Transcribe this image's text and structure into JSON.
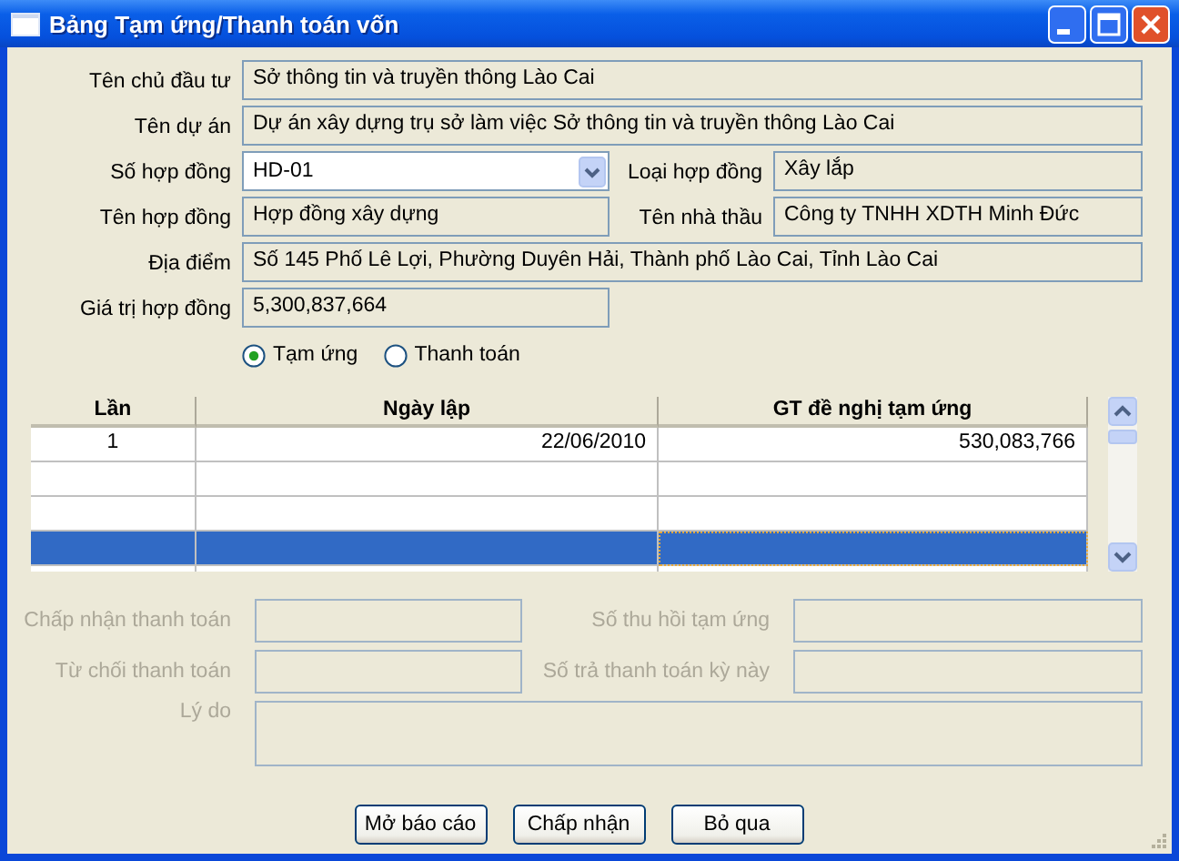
{
  "window": {
    "title": "Bảng Tạm ứng/Thanh toán vốn"
  },
  "fields": [
    {
      "kind": "wide",
      "label": "Tên chủ đầu tư",
      "value": "Sở thông tin và truyền thông Lào Cai"
    },
    {
      "kind": "wide",
      "label": "Tên dự án",
      "value": "Dự án xây dựng trụ sở làm việc Sở thông tin và truyền thông Lào Cai"
    },
    {
      "kind": "combo",
      "label": "Số hợp đồng",
      "value": "HD-01"
    },
    {
      "kind": "half",
      "label": "Loại hợp đồng",
      "value": "Xây lắp"
    },
    {
      "kind": "half",
      "label": "Tên hợp đồng",
      "value": "Hợp đồng xây dựng"
    },
    {
      "kind": "half",
      "label": "Tên nhà thầu",
      "value": "Công ty TNHH XDTH Minh Đức"
    },
    {
      "kind": "wide",
      "label": "Địa điểm",
      "value": "Số 145 Phố Lê Lợi, Phường Duyên Hải, Thành phố Lào Cai, Tỉnh Lào Cai"
    },
    {
      "kind": "half",
      "label": "Giá trị hợp đồng",
      "value": "5,300,837,664"
    }
  ],
  "radios": [
    {
      "label": "Tạm ứng",
      "selected": true
    },
    {
      "label": "Thanh toán",
      "selected": false
    }
  ],
  "table": {
    "columns": [
      "Lần",
      "Ngày lập",
      "GT đề nghị tạm ứng"
    ],
    "rows": [
      {
        "cells": [
          "1",
          "22/06/2010",
          "530,083,766"
        ],
        "selected": false
      },
      {
        "cells": [],
        "selected": false
      },
      {
        "cells": [],
        "selected": false
      },
      {
        "cells": [],
        "selected": true
      },
      {
        "cells": [],
        "selected": false
      }
    ]
  },
  "bottom_fields": [
    {
      "kind": "half",
      "label": "Chấp nhận thanh toán",
      "disabled": true
    },
    {
      "kind": "half",
      "label": "Số thu hồi tạm ứng",
      "disabled": true
    },
    {
      "kind": "half",
      "label": "Từ chối thanh toán",
      "disabled": true
    },
    {
      "kind": "half",
      "label": "Số trả thanh toán kỳ này",
      "disabled": true
    },
    {
      "kind": "memo",
      "label": "Lý do",
      "disabled": true
    }
  ],
  "buttons": [
    "Mở báo cáo",
    "Chấp nhận",
    "Bỏ qua"
  ]
}
